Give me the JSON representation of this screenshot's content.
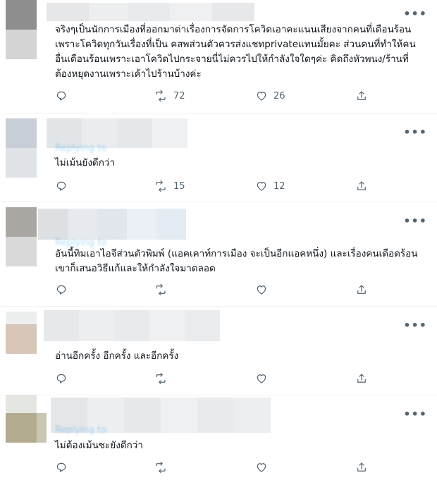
{
  "tweets": [
    {
      "text": "จริงๆเป็นนักการเมืองที่ออกมาด่าเรื่องการจัดการโควิดเอาคะแนนเสียงจากคนที่เดือนร้อนเพราะโควิดทุกวันเรื่องที่เป็น คสพส่วนตัวควรส่งแชทprivateแทนมั้ยคะ ส่วนคนที่ทำให้คนอื่นเดือนร้อนเพราะเอาโควิดไปกระจายนี่ไม่ควรไปให้กำลังใจใดๆค่ะ คิดถึงหัวพนง/ร้านที่ต้องหยุดงานเพราะเค้าไปร้านบ้างค่ะ",
      "replying_to": "",
      "retweets": "72",
      "likes": "26"
    },
    {
      "text": "ไม่เม้นยังดีกว่า",
      "replying_to": "Replying to",
      "retweets": "15",
      "likes": "12"
    },
    {
      "text": "อันนี้ทิมเอาไอจีส่วนตัวพิมพ์ (แอคเคาท์การเมือง จะเป็นอีกแอคหนึ่ง) และเรื่องคนเดือดร้อนเขาก็เสนอวิธีแก้และให้กำลังใจมาตลอด",
      "replying_to": "Replying to",
      "retweets": "",
      "likes": ""
    },
    {
      "text": "อ่านอีกครั้ง อีกครั้ง และอีกครั้ง",
      "replying_to": "",
      "retweets": "",
      "likes": ""
    },
    {
      "text": "ไม่ต้องเม้นซะยังดีกว่า",
      "replying_to": "Replying to",
      "retweets": "",
      "likes": ""
    }
  ],
  "more_label": "•••",
  "colors": {
    "icon": "#536471",
    "text": "#0f1419",
    "link": "#1d9bf0",
    "divider": "#eff3f4"
  },
  "icons": [
    "reply-icon",
    "retweet-icon",
    "like-icon",
    "share-icon",
    "more-icon"
  ]
}
